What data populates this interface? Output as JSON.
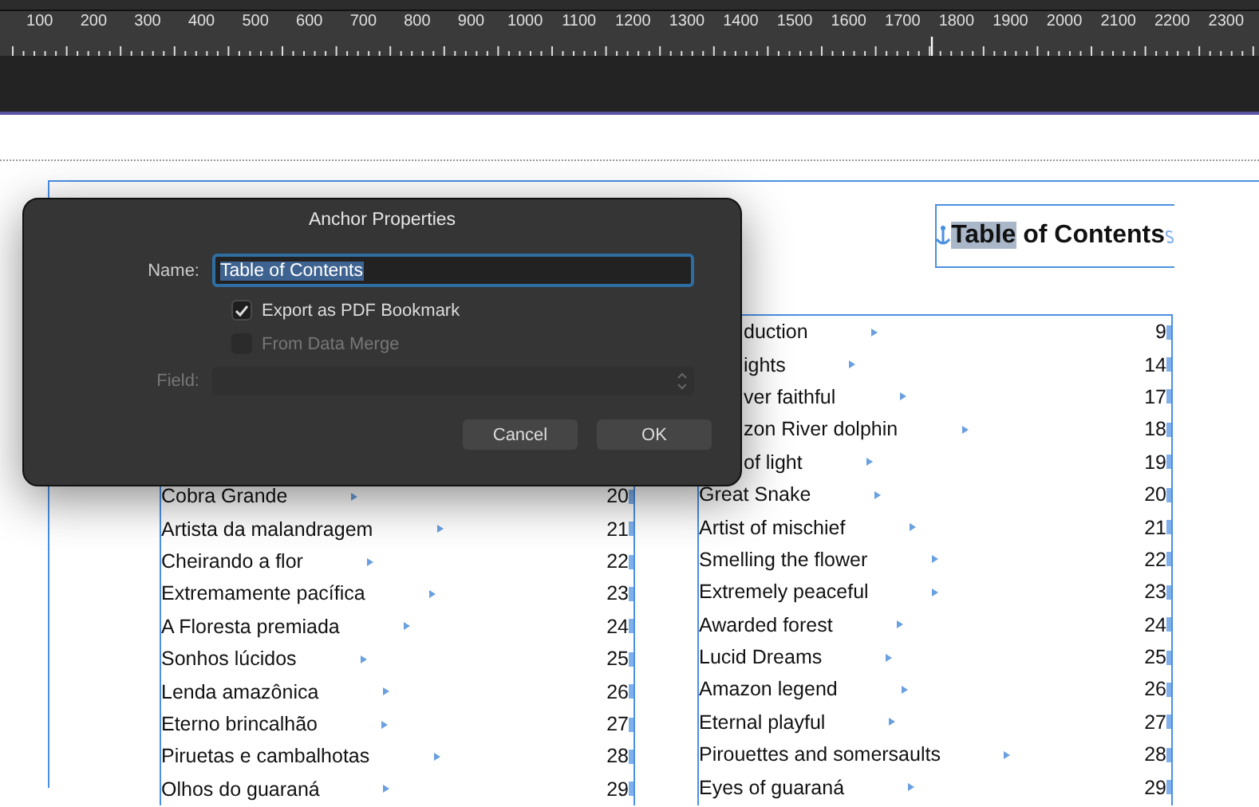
{
  "ruler": {
    "labels": [
      "100",
      "200",
      "300",
      "400",
      "500",
      "600",
      "700",
      "800",
      "900",
      "1000",
      "1100",
      "1200",
      "1300",
      "1400",
      "1500",
      "1600",
      "1700",
      "1800",
      "1900",
      "2000",
      "2100",
      "2200",
      "2300"
    ]
  },
  "heading": {
    "parts": [
      {
        "text": "Table",
        "selected": true
      },
      {
        "text": " of Contents",
        "selected": false
      }
    ]
  },
  "columns": [
    {
      "entries": [
        {
          "title": "Cobra Grande",
          "page": "20"
        },
        {
          "title": "Artista da malandragem",
          "page": "21"
        },
        {
          "title": "Cheirando a flor",
          "page": "22"
        },
        {
          "title": "Extremamente pacífica",
          "page": "23"
        },
        {
          "title": "A Floresta premiada",
          "page": "24"
        },
        {
          "title": "Sonhos lúcidos",
          "page": "25"
        },
        {
          "title": "Lenda amazônica",
          "page": "26"
        },
        {
          "title": "Eterno brincalhão",
          "page": "27"
        },
        {
          "title": "Piruetas e cambalhotas",
          "page": "28"
        },
        {
          "title": "Olhos do guaraná",
          "page": "29"
        }
      ]
    },
    {
      "entries": [
        {
          "title": "duction",
          "page": "9"
        },
        {
          "title": "ights",
          "page": "14"
        },
        {
          "title": "ver faithful",
          "page": "17"
        },
        {
          "title": "zon River dolphin",
          "page": "18"
        },
        {
          "title": "of light",
          "page": "19"
        },
        {
          "title": "Great Snake",
          "page": "20"
        },
        {
          "title": "Artist of mischief",
          "page": "21"
        },
        {
          "title": "Smelling the flower",
          "page": "22"
        },
        {
          "title": "Extremely peaceful",
          "page": "23"
        },
        {
          "title": "Awarded forest",
          "page": "24"
        },
        {
          "title": "Lucid Dreams",
          "page": "25"
        },
        {
          "title": "Amazon legend",
          "page": "26"
        },
        {
          "title": "Eternal playful",
          "page": "27"
        },
        {
          "title": "Pirouettes and somersaults",
          "page": "28"
        },
        {
          "title": "Eyes of guaraná",
          "page": "29"
        }
      ]
    }
  ],
  "dialog": {
    "title": "Anchor Properties",
    "name_label": "Name:",
    "name_value": "Table of Contents",
    "name_selected": true,
    "options": [
      {
        "label": "Export as PDF Bookmark",
        "checked": true,
        "disabled": false
      },
      {
        "label": "From Data Merge",
        "checked": false,
        "disabled": true
      }
    ],
    "field_label": "Field:",
    "field_disabled": true,
    "buttons": [
      "Cancel",
      "OK"
    ]
  }
}
